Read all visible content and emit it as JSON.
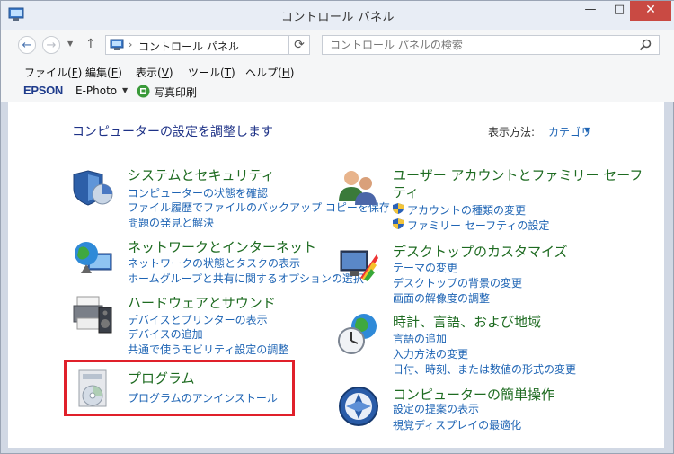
{
  "window": {
    "title": "コントロール パネル"
  },
  "titlebar_buttons": {
    "minimize": "—",
    "maximize": "□",
    "close": "✕"
  },
  "address": {
    "path_label": "コントロール パネル",
    "sep1": "›",
    "sep2": "›"
  },
  "search": {
    "placeholder": "コントロール パネルの検索"
  },
  "menu": {
    "items": [
      {
        "label": "ファイル(",
        "key": "F",
        "end": ")"
      },
      {
        "label": "編集(",
        "key": "E",
        "end": ")"
      },
      {
        "label": "表示(",
        "key": "V",
        "end": ")"
      },
      {
        "label": "ツール(",
        "key": "T",
        "end": ")"
      },
      {
        "label": "ヘルプ(",
        "key": "H",
        "end": ")"
      }
    ]
  },
  "epson": {
    "logo": "EPSON",
    "ephoto": "E-Photo",
    "print_label": "写真印刷"
  },
  "main": {
    "title": "コンピューターの設定を調整します",
    "view_label": "表示方法:",
    "view_value": "カテゴリ"
  },
  "categories": {
    "system": {
      "title": "システムとセキュリティ",
      "links": [
        "コンピューターの状態を確認",
        "ファイル履歴でファイルのバックアップ コピーを保存",
        "問題の発見と解決"
      ]
    },
    "network": {
      "title": "ネットワークとインターネット",
      "links": [
        "ネットワークの状態とタスクの表示",
        "ホームグループと共有に関するオプションの選択"
      ]
    },
    "hardware": {
      "title": "ハードウェアとサウンド",
      "links": [
        "デバイスとプリンターの表示",
        "デバイスの追加",
        "共通で使うモビリティ設定の調整"
      ]
    },
    "programs": {
      "title": "プログラム",
      "links": [
        "プログラムのアンインストール"
      ]
    },
    "users": {
      "title_line1": "ユーザー アカウントとファミリー セーフ",
      "title_line2": "ティ",
      "links": [
        "アカウントの種類の変更",
        "ファミリー セーフティの設定"
      ]
    },
    "appearance": {
      "title": "デスクトップのカスタマイズ",
      "links": [
        "テーマの変更",
        "デスクトップの背景の変更",
        "画面の解像度の調整"
      ]
    },
    "clock": {
      "title": "時計、言語、および地域",
      "links": [
        "言語の追加",
        "入力方法の変更",
        "日付、時刻、または数値の形式の変更"
      ]
    },
    "ease": {
      "title": "コンピューターの簡単操作",
      "links": [
        "設定の提案の表示",
        "視覚ディスプレイの最適化"
      ]
    }
  },
  "colors": {
    "highlight": "#e0202a",
    "link": "#1e64b4",
    "category_title": "#1e6b21",
    "page_title": "#1e3287"
  }
}
